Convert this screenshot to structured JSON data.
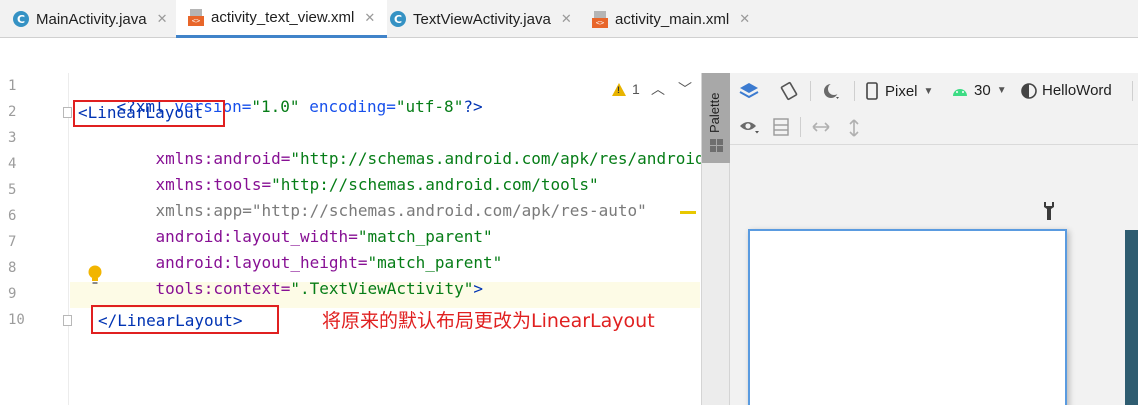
{
  "tabs": [
    {
      "label": "MainActivity.java",
      "icon": "java-class-icon",
      "active": false
    },
    {
      "label": "activity_text_view.xml",
      "icon": "xml-layout-icon",
      "active": true
    },
    {
      "label": "TextViewActivity.java",
      "icon": "java-class-icon",
      "active": false
    },
    {
      "label": "activity_main.xml",
      "icon": "xml-layout-icon",
      "active": false
    }
  ],
  "tab_close_glyph": "✕",
  "editor": {
    "line_numbers": [
      "1",
      "2",
      "3",
      "4",
      "5",
      "6",
      "7",
      "8",
      "9",
      "10"
    ],
    "lines": {
      "l1_decl_open": "<?xml ",
      "l1_version_attr": "version=",
      "l1_version_val": "\"1.0\"",
      "l1_encoding_attr": " encoding=",
      "l1_encoding_val": "\"utf-8\"",
      "l1_decl_close": "?>",
      "l2_tag": "<LinearLayout",
      "l3_attr": "xmlns:android=",
      "l3_val": "\"http://schemas.android.com/apk/res/android\"",
      "l4_attr": "xmlns:tools=",
      "l4_val": "\"http://schemas.android.com/tools\"",
      "l5_attr": "xmlns:app=",
      "l5_val": "\"http://schemas.android.com/apk/res-auto\"",
      "l6_attr": "android:layout_width=",
      "l6_val": "\"match_parent\"",
      "l7_attr": "android:layout_height=",
      "l7_val": "\"match_parent\"",
      "l8_attr": "tools:context=",
      "l8_val": "\".TextViewActivity\"",
      "l8_close": ">",
      "l10_tag": "</LinearLayout>"
    },
    "warning_count": "1",
    "annotation": "将原来的默认布局更改为LinearLayout"
  },
  "palette_label": "Palette",
  "design_toolbar": {
    "device": "Pixel",
    "api_level": "30",
    "theme": "HelloWord"
  },
  "colors": {
    "annotation_red": "#e02020",
    "active_tab_underline": "#4083c9",
    "xml_tag_blue": "#0033b3",
    "xml_attr_purple": "#871094",
    "xml_string_green": "#067d17"
  }
}
